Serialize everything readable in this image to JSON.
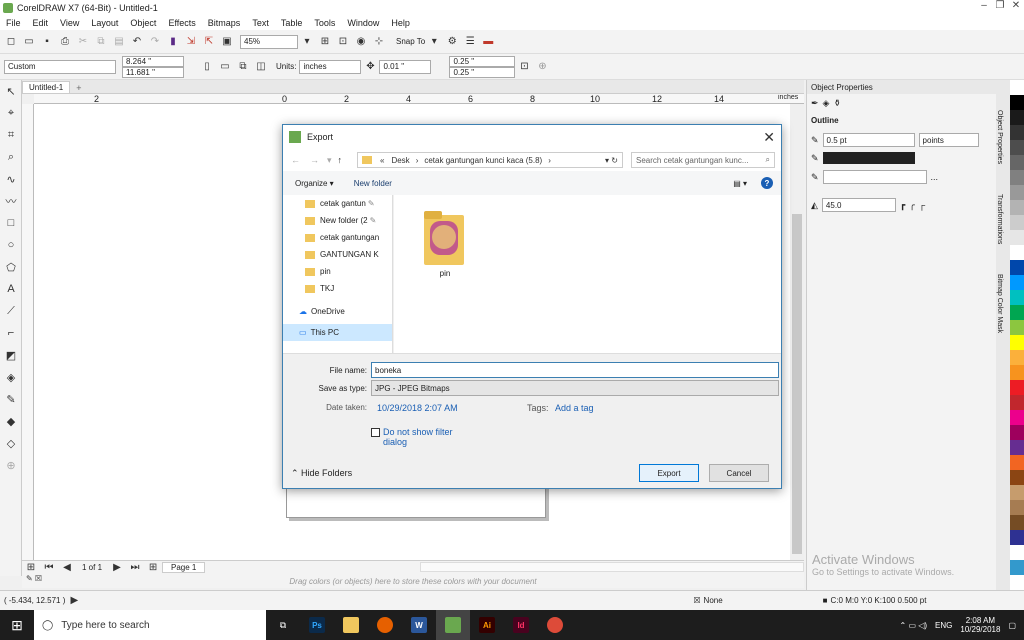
{
  "window": {
    "title": "CorelDRAW X7 (64-Bit) - Untitled-1"
  },
  "menu": [
    "File",
    "Edit",
    "View",
    "Layout",
    "Object",
    "Effects",
    "Bitmaps",
    "Text",
    "Table",
    "Tools",
    "Window",
    "Help"
  ],
  "toolbar": {
    "zoom": "45%",
    "snap_label": "Snap To"
  },
  "propbar": {
    "preset": "Custom",
    "width": "8.264 \"",
    "height": "11.681 \"",
    "units_label": "Units:",
    "units": "inches",
    "nudge": "0.01 \"",
    "dup_x": "0.25 \"",
    "dup_y": "0.25 \""
  },
  "doc": {
    "tab": "Untitled-1",
    "ruler_unit": "inches",
    "ruler_marks": [
      "2",
      "0",
      "2",
      "4",
      "6",
      "8",
      "10",
      "12",
      "14"
    ]
  },
  "pagebar": {
    "page_count": "1 of 1",
    "page_tab": "Page 1"
  },
  "colorbar": {
    "hint": "Drag colors (or objects) here to store these colors with your document"
  },
  "status": {
    "coords": "( -5.434, 12.571 )",
    "fill": "None",
    "outline": "C:0 M:0 Y:0 K:100  0.500 pt"
  },
  "objprops": {
    "title": "Object Properties",
    "section": "Outline",
    "width": "0.5 pt",
    "units": "points",
    "miter": "45.0",
    "more": "..."
  },
  "dockers": [
    "Object Properties",
    "Transformations",
    "Bitmap Color Mask"
  ],
  "activate": {
    "line1": "Activate Windows",
    "line2": "Go to Settings to activate Windows."
  },
  "taskbar": {
    "search": "Type here to search",
    "time": "2:08 AM",
    "date": "10/29/2018",
    "lang": "ENG"
  },
  "dialog": {
    "title": "Export",
    "breadcrumb": [
      "«",
      "Desk",
      "›",
      "cetak gantungan kunci kaca (5.8)",
      "›"
    ],
    "search_placeholder": "Search cetak gantungan kunc...",
    "organize": "Organize ▾",
    "new_folder": "New folder",
    "nav": [
      {
        "label": "cetak gantun",
        "type": "folder",
        "pin": true
      },
      {
        "label": "New folder (2",
        "type": "folder",
        "pin": true
      },
      {
        "label": "cetak gantungan",
        "type": "folder"
      },
      {
        "label": "GANTUNGAN K",
        "type": "folder"
      },
      {
        "label": "pin",
        "type": "folder"
      },
      {
        "label": "TKJ",
        "type": "folder"
      },
      {
        "label": "OneDrive",
        "type": "cloud"
      },
      {
        "label": "This PC",
        "type": "pc",
        "selected": true
      }
    ],
    "files": [
      {
        "name": "pin"
      }
    ],
    "filename_label": "File name:",
    "filename": "boneka",
    "type_label": "Save as type:",
    "type": "JPG - JPEG Bitmaps",
    "date_label": "Date taken:",
    "date": "10/29/2018 2:07 AM",
    "tags_label": "Tags:",
    "tags": "Add a tag",
    "checkbox": "Do not show filter dialog",
    "hide_folders": "Hide Folders",
    "export_btn": "Export",
    "cancel_btn": "Cancel"
  },
  "palette": [
    "#ffffff",
    "#000000",
    "#1a1a1a",
    "#333333",
    "#4d4d4d",
    "#666666",
    "#808080",
    "#999999",
    "#b3b3b3",
    "#cccccc",
    "#e6e6e6",
    "#ffffff",
    "#0047ab",
    "#0099ff",
    "#00c0c0",
    "#00a651",
    "#8cc63f",
    "#ffff00",
    "#fbb03b",
    "#f7931e",
    "#ed1c24",
    "#c1272d",
    "#ec008c",
    "#9e005d",
    "#662d91",
    "#f26522",
    "#8b4513",
    "#c69c6d",
    "#a67c52",
    "#754c24",
    "#2e3192",
    "#ffffff",
    "#3399cc"
  ]
}
